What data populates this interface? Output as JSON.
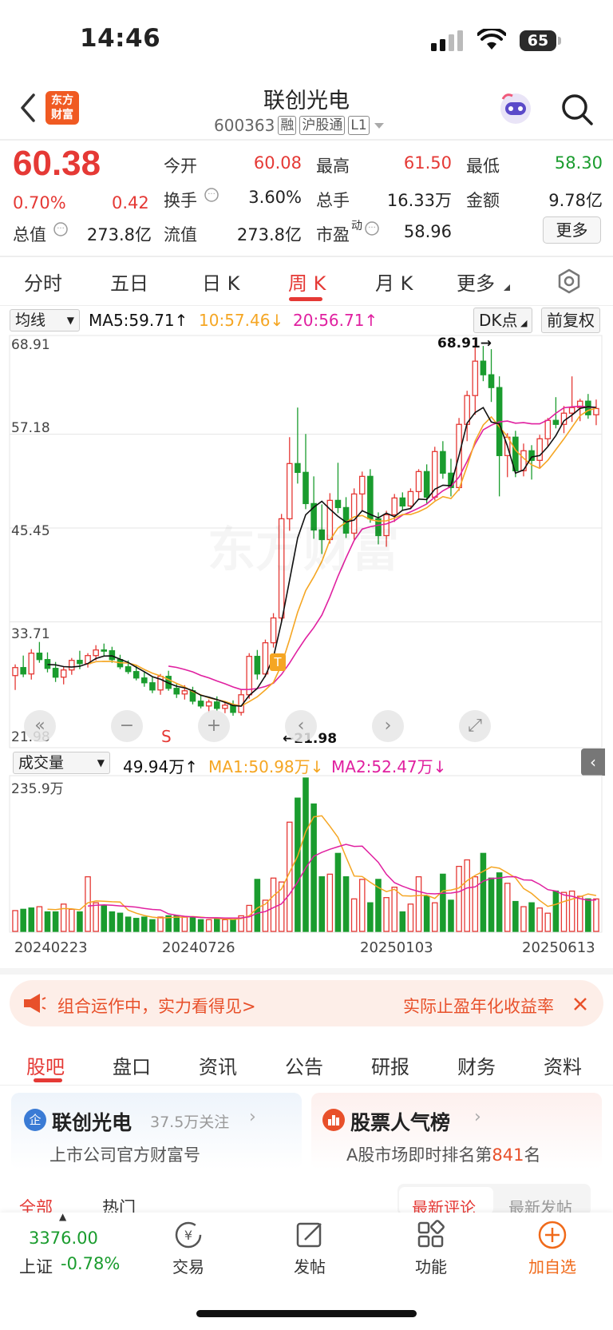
{
  "status": {
    "time": "14:46",
    "battery": "65"
  },
  "header": {
    "logo": "东方\n财富",
    "title": "联创光电",
    "code": "600363",
    "tags": [
      "融",
      "沪股通",
      "L1"
    ]
  },
  "quote": {
    "price": "60.38",
    "change_pct": "0.70%",
    "change": "0.42",
    "open_label": "今开",
    "open": "60.08",
    "high_label": "最高",
    "high": "61.50",
    "low_label": "最低",
    "low": "58.30",
    "turnover_label": "换手",
    "turnover": "3.60%",
    "volume_label": "总手",
    "volume": "16.33万",
    "amount_label": "金额",
    "amount": "9.78亿",
    "mcap_label": "总值",
    "mcap": "273.8亿",
    "float_label": "流值",
    "float": "273.8亿",
    "pe_label": "市盈",
    "pe_sup": "动",
    "pe": "58.96",
    "more_label": "更多"
  },
  "period_tabs": [
    "分时",
    "五日",
    "日 K",
    "周 K",
    "月 K",
    "更多"
  ],
  "active_period": "周 K",
  "ma_legend": {
    "selector": "均线",
    "ma5": "MA5:59.71↑",
    "ma10": "10:57.46↓",
    "ma20": "20:56.71↑",
    "dk": "DK点",
    "adjust": "前复权",
    "colors": {
      "ma5": "#111111",
      "ma10": "#f5a623",
      "ma20": "#e020a0"
    }
  },
  "price_axis": [
    "68.91",
    "57.18",
    "45.45",
    "33.71",
    "21.98"
  ],
  "annotations": {
    "max": "68.91→",
    "min": "←21.98",
    "t_marker": "T",
    "s_marker": "S"
  },
  "watermark": "东方财富",
  "volume_legend": {
    "selector": "成交量",
    "vol": "49.94万↑",
    "ma1": "MA1:50.98万↓",
    "ma2": "MA2:52.47万↓",
    "max": "235.9万"
  },
  "date_axis": [
    "20240223",
    "20240726",
    "20250103",
    "20250613"
  ],
  "banner": {
    "left_text": "组合运作中，实力看得见>",
    "right_text": "实际止盈年化收益率"
  },
  "bottom_tabs": [
    "股吧",
    "盘口",
    "资讯",
    "公告",
    "研报",
    "财务",
    "资料"
  ],
  "cards": {
    "company": {
      "badge": "企",
      "name": "联创光电",
      "follow": "37.5万关注",
      "sub": "上市公司官方财富号"
    },
    "rank": {
      "name": "股票人气榜",
      "sub_prefix": "A股市场即时排名第",
      "rank": "841",
      "sub_suffix": "名"
    }
  },
  "sub_tabs": {
    "all": "全部",
    "hot": "热门",
    "latest_comment": "最新评论",
    "latest_post": "最新发帖"
  },
  "bottom_bar": {
    "index_value": "3376.00",
    "index_name": "上证",
    "index_change": "-0.78%",
    "trade": "交易",
    "post": "发帖",
    "func": "功能",
    "add": "加自选"
  },
  "chart_data": {
    "type": "candlestick",
    "title": "联创光电 周K",
    "ylim": [
      21.98,
      68.91
    ],
    "candles": [
      [
        27,
        28.4,
        25.2,
        28
      ],
      [
        28,
        29.5,
        26.8,
        27.2
      ],
      [
        27.2,
        30.3,
        26.5,
        29.8
      ],
      [
        29.8,
        31.2,
        28.6,
        29
      ],
      [
        29,
        29.9,
        27.4,
        27.9
      ],
      [
        27.9,
        28.7,
        26.2,
        26.8
      ],
      [
        26.8,
        28.1,
        25.9,
        27.7
      ],
      [
        27.7,
        29.2,
        27.1,
        28.9
      ],
      [
        28.9,
        30.1,
        27.8,
        28.5
      ],
      [
        28.5,
        29.8,
        28,
        29.5
      ],
      [
        29.5,
        30.8,
        28.9,
        30.2
      ],
      [
        30.2,
        31,
        29.5,
        30.1
      ],
      [
        30.1,
        30.6,
        28.6,
        29
      ],
      [
        29,
        29.6,
        27.8,
        28.1
      ],
      [
        28.1,
        28.9,
        27.2,
        27.5
      ],
      [
        27.5,
        28.3,
        26.4,
        26.7
      ],
      [
        26.7,
        27.5,
        25.6,
        26.1
      ],
      [
        26.1,
        26.8,
        24.8,
        25.2
      ],
      [
        25.2,
        27.2,
        24.6,
        26.9
      ],
      [
        26.9,
        27.6,
        25.1,
        25.4
      ],
      [
        25.4,
        26,
        24.2,
        24.7
      ],
      [
        24.7,
        25.8,
        24,
        25.1
      ],
      [
        25.1,
        25.6,
        23.4,
        23.8
      ],
      [
        23.8,
        24.6,
        22.9,
        23.2
      ],
      [
        23.2,
        24,
        22.4,
        23.7
      ],
      [
        23.7,
        24.4,
        22.6,
        22.9
      ],
      [
        22.9,
        23.8,
        22.3,
        23.3
      ],
      [
        23.3,
        23.9,
        21.98,
        22.4
      ],
      [
        22.4,
        25.2,
        22,
        24.6
      ],
      [
        24.6,
        29.8,
        24.1,
        29.4
      ],
      [
        29.4,
        30.2,
        26.5,
        27.2
      ],
      [
        27.2,
        31.5,
        26.8,
        31.1
      ],
      [
        31.1,
        34.8,
        30.5,
        34.2
      ],
      [
        34.2,
        47.2,
        33.8,
        46.6
      ],
      [
        46.6,
        56.8,
        45.1,
        53.5
      ],
      [
        53.5,
        60.5,
        51,
        52.4
      ],
      [
        52.4,
        57.2,
        47.8,
        48.5
      ],
      [
        48.5,
        51.9,
        44.1,
        45.2
      ],
      [
        45.2,
        48.4,
        42.2,
        44
      ],
      [
        44,
        49.8,
        43.5,
        48.9
      ],
      [
        48.9,
        53.6,
        47.3,
        48
      ],
      [
        48,
        49.3,
        44.2,
        44.8
      ],
      [
        44.8,
        50.4,
        44,
        49.7
      ],
      [
        49.7,
        52.5,
        47.6,
        51.9
      ],
      [
        51.9,
        52.8,
        46.1,
        46.6
      ],
      [
        46.6,
        47.4,
        43.4,
        44.5
      ],
      [
        44.5,
        47.6,
        43.1,
        47.1
      ],
      [
        47.1,
        49.7,
        46.2,
        49.2
      ],
      [
        49.2,
        49.9,
        47.6,
        48.2
      ],
      [
        48.2,
        50.4,
        47.8,
        50
      ],
      [
        50,
        52.8,
        49.1,
        52.5
      ],
      [
        52.5,
        53.4,
        48.5,
        49.3
      ],
      [
        49.3,
        55.6,
        48.9,
        55
      ],
      [
        55,
        56.3,
        51.6,
        52.3
      ],
      [
        52.3,
        54.1,
        49.4,
        50.5
      ],
      [
        50.5,
        59.2,
        50.1,
        58.4
      ],
      [
        58.4,
        62.6,
        56.3,
        62
      ],
      [
        62,
        68.91,
        59.6,
        66.3
      ],
      [
        66.3,
        68.2,
        63.8,
        64.6
      ],
      [
        64.6,
        67.8,
        61.2,
        63
      ],
      [
        63,
        64.4,
        49.4,
        54.5
      ],
      [
        54.5,
        57.3,
        51.8,
        56.8
      ],
      [
        56.8,
        57.6,
        51.8,
        52.6
      ],
      [
        52.6,
        56,
        51.9,
        55.1
      ],
      [
        55.1,
        55.8,
        51.5,
        53.9
      ],
      [
        53.9,
        57.1,
        53,
        56.6
      ],
      [
        56.6,
        59.2,
        55.6,
        58.9
      ],
      [
        58.9,
        61.8,
        57.9,
        58.4
      ],
      [
        58.4,
        60.7,
        57.3,
        59.8
      ],
      [
        59.8,
        64.4,
        58.7,
        60.5
      ],
      [
        60.5,
        61.6,
        58.8,
        61.3
      ],
      [
        61.3,
        62.2,
        59.1,
        59.6
      ],
      [
        59.6,
        61.5,
        58.3,
        60.38
      ]
    ],
    "ma5": [
      null,
      null,
      null,
      null,
      28.38,
      28.34,
      28.12,
      28.06,
      28.16,
      28.5,
      29.14,
      29.44,
      29.46,
      29.04,
      28.64,
      28.04,
      27.48,
      26.86,
      26.54,
      26.06,
      25.66,
      25.46,
      25.12,
      24.54,
      24.3,
      24.0,
      23.66,
      23.26,
      23.18,
      24.52,
      25.38,
      26.98,
      29.3,
      33.7,
      38.92,
      44.2,
      47.1,
      48.04,
      48.78,
      47.8,
      46.9,
      46.18,
      46.44,
      47.6,
      47.14,
      46.72,
      47.3,
      46.86,
      47.66,
      47.88,
      49.06,
      49.0,
      50.3,
      50.8,
      50.74,
      54.52,
      58.56,
      59.88,
      60.5,
      58.7,
      58.46,
      55.7,
      52.3,
      52.7,
      54.32,
      54.5,
      55.6,
      57.0,
      58.84,
      59.56,
      60.4,
      60.6,
      60.52
    ],
    "ma10": [
      null,
      null,
      null,
      null,
      null,
      null,
      null,
      null,
      null,
      28.44,
      28.74,
      28.78,
      28.76,
      28.6,
      28.57,
      28.29,
      27.76,
      27.3,
      26.96,
      26.5,
      26.02,
      25.57,
      25.0,
      24.59,
      24.22,
      23.98,
      23.76,
      23.42,
      23.19,
      23.75,
      24.35,
      25.22,
      26.16,
      28.33,
      31.51,
      34.92,
      37.63,
      39.33,
      41.26,
      43.93,
      45.44,
      46.16,
      46.84,
      47.01,
      46.49,
      46.3,
      46.34,
      46.68,
      47.14,
      47.13,
      47.48,
      47.97,
      48.78,
      49.37,
      49.13,
      50.29,
      53.16,
      56.31,
      58.32,
      59.33,
      58.12,
      56.88,
      55.19,
      54.16,
      53.34,
      52.9,
      53.9,
      55.24,
      56.59,
      58.04,
      59.48,
      60.14,
      60.42
    ],
    "ma20": [
      null,
      null,
      null,
      null,
      null,
      null,
      null,
      null,
      null,
      null,
      null,
      null,
      null,
      null,
      null,
      null,
      null,
      null,
      null,
      28.18,
      28.02,
      27.76,
      27.46,
      27.02,
      26.71,
      26.32,
      25.97,
      25.57,
      25.26,
      25.27,
      25.37,
      25.63,
      26.05,
      27.14,
      28.56,
      30.17,
      31.67,
      32.99,
      34.55,
      36.84,
      39.4,
      41.71,
      43.9,
      45.32,
      45.6,
      45.79,
      45.95,
      46.34,
      47.06,
      47.46,
      47.93,
      48.45,
      49.33,
      50.1,
      50.64,
      51.82,
      53.77,
      55.97,
      57.72,
      58.3,
      58.71,
      58.82,
      58.55,
      58.62,
      58.47,
      58.47,
      58.95,
      59.78,
      60.47,
      60.59,
      60.66,
      60.56,
      60.47
    ],
    "volume": [
      32,
      34,
      36,
      38,
      30,
      30,
      42,
      34,
      30,
      84,
      44,
      40,
      30,
      28,
      22,
      20,
      22,
      18,
      22,
      24,
      24,
      22,
      22,
      18,
      18,
      20,
      18,
      18,
      24,
      40,
      80,
      48,
      82,
      76,
      168,
      205,
      235.9,
      196,
      84,
      88,
      120,
      84,
      50,
      80,
      44,
      80,
      52,
      68,
      30,
      42,
      84,
      54,
      44,
      88,
      48,
      100,
      110,
      84,
      120,
      82,
      90,
      74,
      46,
      38,
      44,
      36,
      28,
      62,
      60,
      62,
      54,
      50,
      49.94
    ],
    "volume_up": [
      true,
      false,
      false,
      true,
      false,
      false,
      true,
      true,
      false,
      true,
      true,
      false,
      false,
      false,
      false,
      false,
      false,
      false,
      true,
      false,
      false,
      true,
      false,
      false,
      true,
      false,
      true,
      false,
      true,
      true,
      false,
      true,
      true,
      true,
      true,
      false,
      false,
      false,
      false,
      true,
      false,
      false,
      true,
      true,
      false,
      false,
      true,
      true,
      false,
      true,
      true,
      false,
      true,
      false,
      false,
      true,
      true,
      true,
      false,
      false,
      false,
      true,
      false,
      true,
      false,
      true,
      true,
      false,
      true,
      true,
      true,
      false,
      true
    ]
  }
}
